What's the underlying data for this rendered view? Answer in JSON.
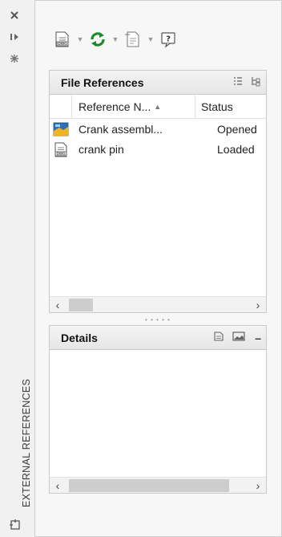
{
  "palette": {
    "title": "EXTERNAL REFERENCES",
    "buttons": [
      "close-icon",
      "auto-hide-icon",
      "properties-icon"
    ],
    "footer_icon": "xref-palette-icon"
  },
  "toolbar": {
    "items": [
      "attach-dwg-icon",
      "refresh-icon",
      "change-path-icon",
      "help-icon"
    ]
  },
  "file_references": {
    "title": "File References",
    "columns": [
      "Reference N...",
      "Status"
    ],
    "rows": [
      {
        "name": "Crank assembl...",
        "status": "Opened",
        "icon": "drawing-icon"
      },
      {
        "name": "crank pin",
        "status": "Loaded",
        "icon": "dwg-icon"
      }
    ]
  },
  "details": {
    "title": "Details",
    "collapse": "–"
  }
}
